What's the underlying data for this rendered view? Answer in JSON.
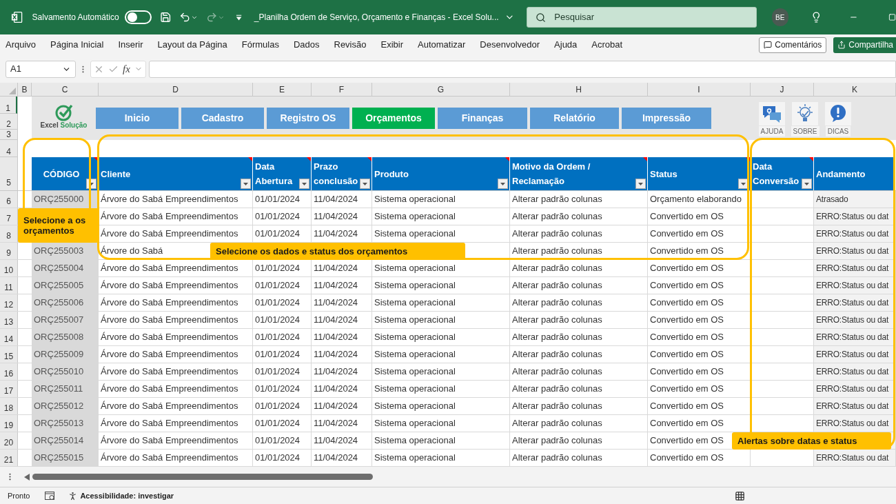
{
  "titlebar": {
    "autosave_label": "Salvamento Automático",
    "autosave_on": false,
    "title": "_Planilha Ordem de Serviço, Orçamento e Finanças - Excel Solu...",
    "search_placeholder": "Pesquisar",
    "avatar": "BE"
  },
  "ribbon_tabs": [
    {
      "label": "Arquivo",
      "selected": false
    },
    {
      "label": "Página Inicial",
      "selected": false
    },
    {
      "label": "Inserir",
      "selected": false
    },
    {
      "label": "Layout da Página",
      "selected": false
    },
    {
      "label": "Fórmulas",
      "selected": false
    },
    {
      "label": "Dados",
      "selected": false
    },
    {
      "label": "Revisão",
      "selected": false
    },
    {
      "label": "Exibir",
      "selected": false
    },
    {
      "label": "Automatizar",
      "selected": false
    },
    {
      "label": "Desenvolvedor",
      "selected": false
    },
    {
      "label": "Ajuda",
      "selected": false
    },
    {
      "label": "Acrobat",
      "selected": false
    }
  ],
  "comments_button": "Comentários",
  "share_button": "Compartilha",
  "formula_bar": {
    "name_box": "A1",
    "fx": "fx"
  },
  "column_letters": [
    "B",
    "C",
    "D",
    "E",
    "F",
    "G",
    "H",
    "I",
    "J",
    "K"
  ],
  "top_row_numbers": [
    "1",
    "2",
    "3",
    "4",
    "5"
  ],
  "logo": {
    "word1": "Excel",
    "word2": "Solução"
  },
  "nav_buttons": [
    {
      "label": "Inicio",
      "selected": false
    },
    {
      "label": "Cadastro",
      "selected": false
    },
    {
      "label": "Registro OS",
      "selected": false
    },
    {
      "label": "Orçamentos",
      "selected": true
    },
    {
      "label": "Finanças",
      "selected": false
    },
    {
      "label": "Relatório",
      "selected": false
    },
    {
      "label": "Impressão",
      "selected": false
    }
  ],
  "info_buttons": [
    {
      "label": "AJUDA",
      "kind": "help"
    },
    {
      "label": "SOBRE",
      "kind": "about"
    },
    {
      "label": "DICAS",
      "kind": "tips"
    }
  ],
  "table": {
    "columns": [
      {
        "label": "CÓDIGO",
        "filter": true,
        "comment": true
      },
      {
        "label": "Cliente",
        "filter": true,
        "comment": true
      },
      {
        "label": "Data Abertura",
        "filter": true,
        "comment": true
      },
      {
        "label": "Prazo conclusão",
        "filter": true,
        "comment": true
      },
      {
        "label": "Produto",
        "filter": true,
        "comment": true
      },
      {
        "label": "Motivo da Ordem / Reclamação",
        "filter": true,
        "comment": true
      },
      {
        "label": "Status",
        "filter": true,
        "comment": true
      },
      {
        "label": "Data Conversão",
        "filter": true,
        "comment": true
      },
      {
        "label": "Andamento",
        "filter": false,
        "comment": false
      }
    ],
    "rows": [
      {
        "row_number": "6",
        "code": "ORÇ255000",
        "client": "Árvore do Sabá Empreendimentos",
        "opened": "01/01/2024",
        "deadline": "11/04/2024",
        "product": "Sistema operacional",
        "reason": "Alterar padrão colunas",
        "status": "Orçamento elaborando",
        "progress": "Atrasado"
      },
      {
        "row_number": "7",
        "client": "Árvore do Sabá Empreendimentos",
        "opened": "01/01/2024",
        "deadline": "11/04/2024",
        "product": "Sistema operacional",
        "reason": "Alterar padrão colunas",
        "status": "Convertido em OS",
        "progress": "ERRO:Status ou dat"
      },
      {
        "row_number": "8",
        "client": "Árvore do Sabá Empreendimentos",
        "opened": "01/01/2024",
        "deadline": "11/04/2024",
        "product": "Sistema operacional",
        "reason": "Alterar padrão colunas",
        "status": "Convertido em OS",
        "progress": "ERRO:Status ou dat"
      },
      {
        "row_number": "9",
        "code": "ORÇ255003",
        "client": "Árvore do Sabá",
        "reason": "Alterar padrão colunas",
        "status": "Convertido em OS",
        "progress": "ERRO:Status ou dat"
      },
      {
        "row_number": "10",
        "code": "ORÇ255004",
        "client": "Árvore do Sabá Empreendimentos",
        "opened": "01/01/2024",
        "deadline": "11/04/2024",
        "product": "Sistema operacional",
        "reason": "Alterar padrão colunas",
        "status": "Convertido em OS",
        "progress": "ERRO:Status ou dat"
      },
      {
        "row_number": "11",
        "code": "ORÇ255005",
        "client": "Árvore do Sabá Empreendimentos",
        "opened": "01/01/2024",
        "deadline": "11/04/2024",
        "product": "Sistema operacional",
        "reason": "Alterar padrão colunas",
        "status": "Convertido em OS",
        "progress": "ERRO:Status ou dat"
      },
      {
        "row_number": "12",
        "code": "ORÇ255006",
        "client": "Árvore do Sabá Empreendimentos",
        "opened": "01/01/2024",
        "deadline": "11/04/2024",
        "product": "Sistema operacional",
        "reason": "Alterar padrão colunas",
        "status": "Convertido em OS",
        "progress": "ERRO:Status ou dat"
      },
      {
        "row_number": "13",
        "code": "ORÇ255007",
        "client": "Árvore do Sabá Empreendimentos",
        "opened": "01/01/2024",
        "deadline": "11/04/2024",
        "product": "Sistema operacional",
        "reason": "Alterar padrão colunas",
        "status": "Convertido em OS",
        "progress": "ERRO:Status ou dat"
      },
      {
        "row_number": "14",
        "code": "ORÇ255008",
        "client": "Árvore do Sabá Empreendimentos",
        "opened": "01/01/2024",
        "deadline": "11/04/2024",
        "product": "Sistema operacional",
        "reason": "Alterar padrão colunas",
        "status": "Convertido em OS",
        "progress": "ERRO:Status ou dat"
      },
      {
        "row_number": "15",
        "code": "ORÇ255009",
        "client": "Árvore do Sabá Empreendimentos",
        "opened": "01/01/2024",
        "deadline": "11/04/2024",
        "product": "Sistema operacional",
        "reason": "Alterar padrão colunas",
        "status": "Convertido em OS",
        "progress": "ERRO:Status ou dat"
      },
      {
        "row_number": "16",
        "code": "ORÇ255010",
        "client": "Árvore do Sabá Empreendimentos",
        "opened": "01/01/2024",
        "deadline": "11/04/2024",
        "product": "Sistema operacional",
        "reason": "Alterar padrão colunas",
        "status": "Convertido em OS",
        "progress": "ERRO:Status ou dat"
      },
      {
        "row_number": "17",
        "code": "ORÇ255011",
        "client": "Árvore do Sabá Empreendimentos",
        "opened": "01/01/2024",
        "deadline": "11/04/2024",
        "product": "Sistema operacional",
        "reason": "Alterar padrão colunas",
        "status": "Convertido em OS",
        "progress": "ERRO:Status ou dat"
      },
      {
        "row_number": "18",
        "code": "ORÇ255012",
        "client": "Árvore do Sabá Empreendimentos",
        "opened": "01/01/2024",
        "deadline": "11/04/2024",
        "product": "Sistema operacional",
        "reason": "Alterar padrão colunas",
        "status": "Convertido em OS",
        "progress": "ERRO:Status ou dat"
      },
      {
        "row_number": "19",
        "code": "ORÇ255013",
        "client": "Árvore do Sabá Empreendimentos",
        "opened": "01/01/2024",
        "deadline": "11/04/2024",
        "product": "Sistema operacional",
        "reason": "Alterar padrão colunas",
        "status": "Convertido em OS",
        "progress": "ERRO:Status ou dat"
      },
      {
        "row_number": "20",
        "code": "ORÇ255014",
        "client": "Árvore do Sabá Empreendimentos",
        "opened": "01/01/2024",
        "deadline": "11/04/2024",
        "product": "Sistema operacional",
        "reason": "Alterar padrão colunas",
        "status": "Convertido em OS"
      },
      {
        "row_number": "21",
        "code": "ORÇ255015",
        "client": "Árvore do Sabá Empreendimentos",
        "opened": "01/01/2024",
        "deadline": "11/04/2024",
        "product": "Sistema operacional",
        "reason": "Alterar padrão colunas",
        "status": "Convertido em OS",
        "progress": "ERRO:Status ou dat"
      }
    ]
  },
  "callouts": [
    {
      "text": "Selecione a os orçamentos",
      "kind": "codes"
    },
    {
      "text": "Selecione os dados e status dos orçamentos",
      "kind": "data"
    },
    {
      "text": "Alertas sobre datas e status",
      "kind": "alerts"
    }
  ],
  "status_bar": {
    "ready": "Pronto",
    "accessibility": "Acessibilidade: investigar"
  }
}
